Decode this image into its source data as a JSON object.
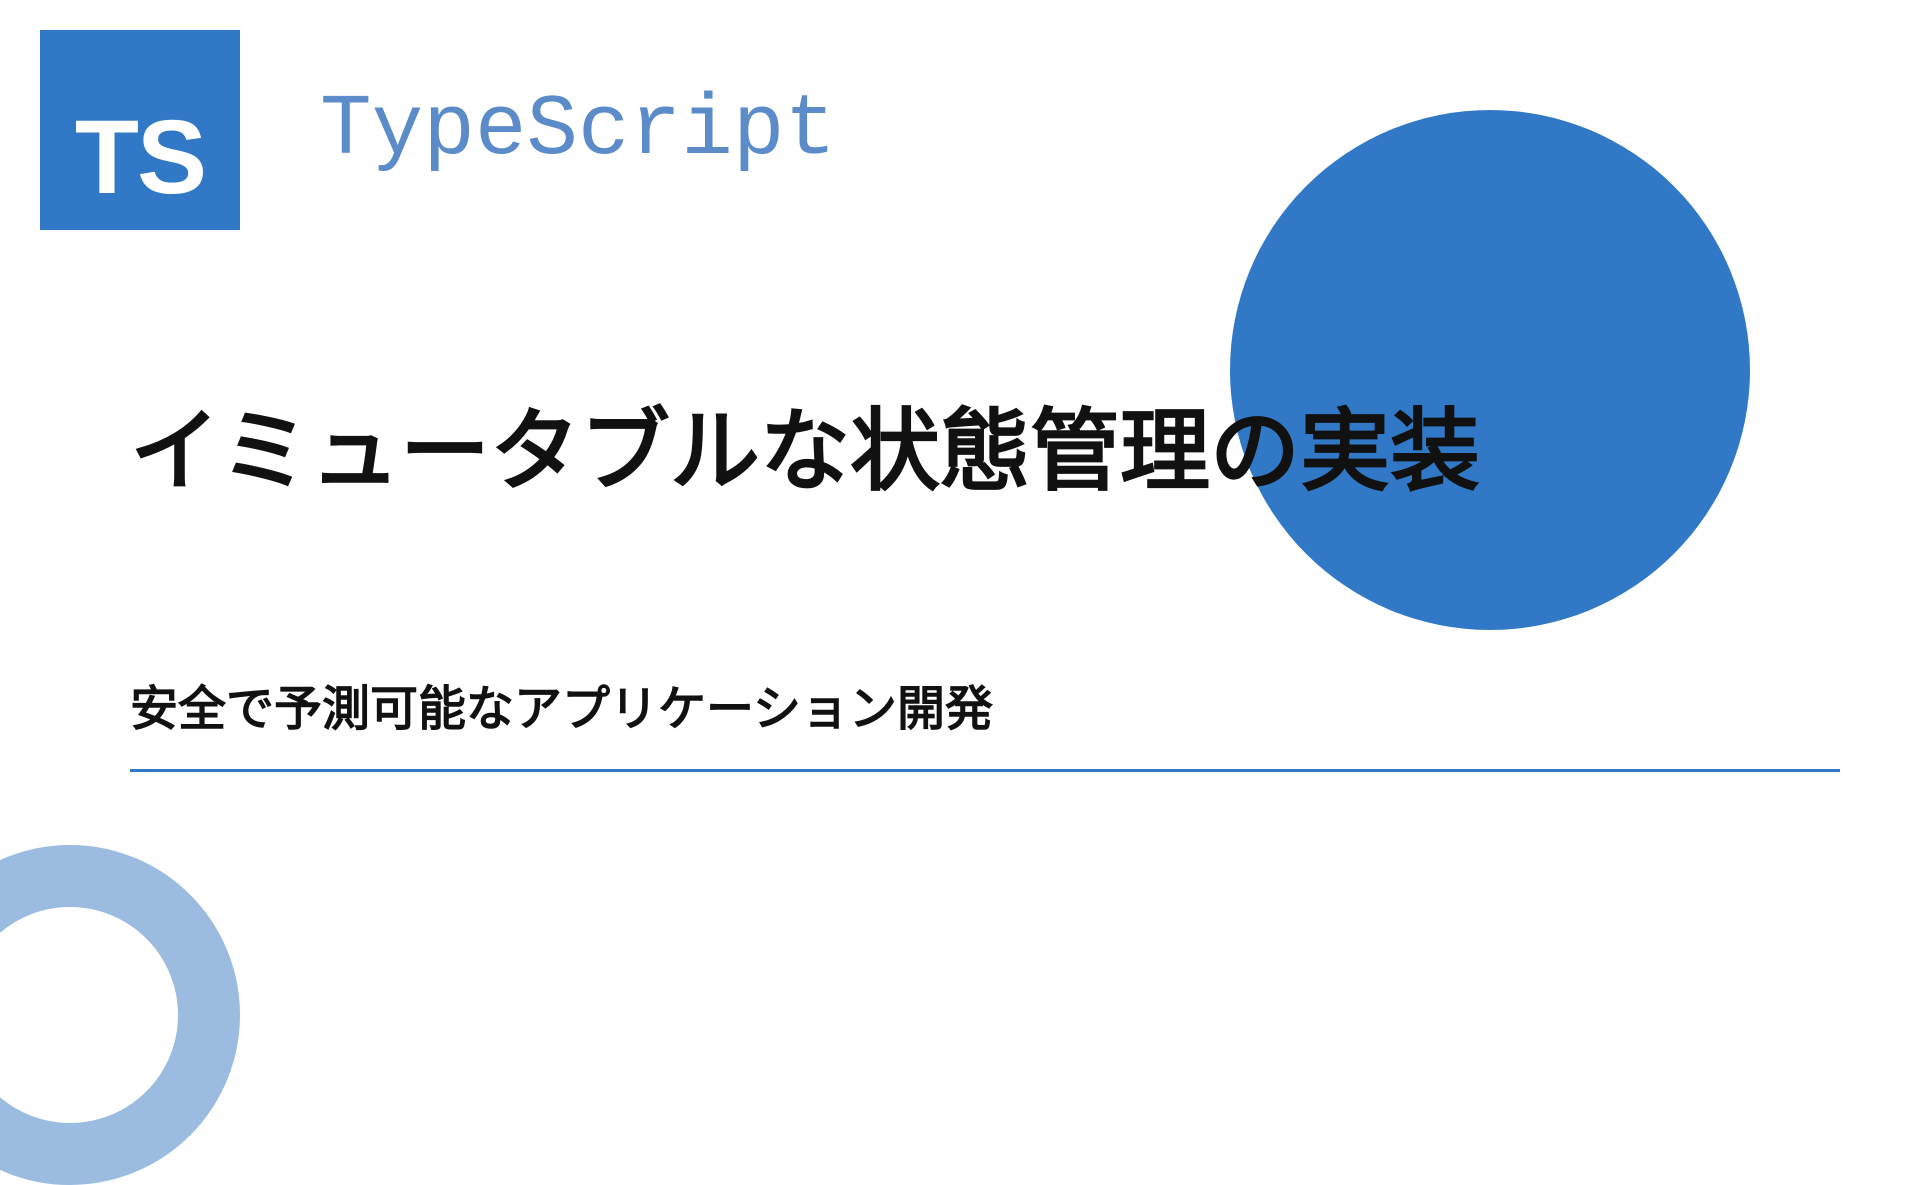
{
  "badge": {
    "text": "TS"
  },
  "header": {
    "label": "TypeScript"
  },
  "title": "イミュータブルな状態管理の実装",
  "subtitle": "安全で予測可能なアプリケーション開発",
  "colors": {
    "primary": "#3178c6",
    "accent": "#9bbce0"
  }
}
